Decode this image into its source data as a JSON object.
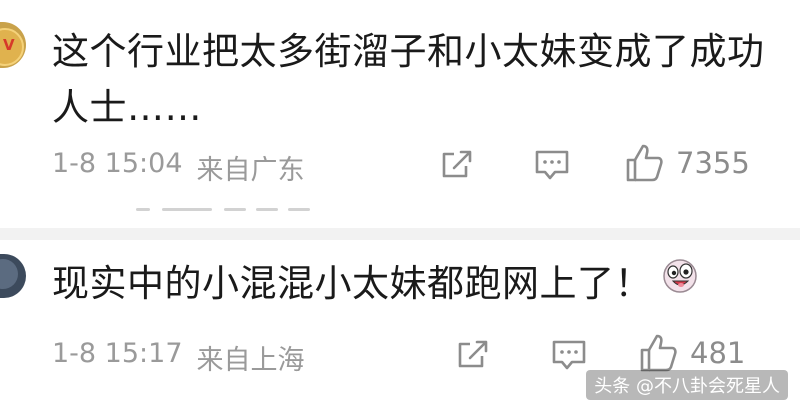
{
  "comments": [
    {
      "text": "这个行业把太多街溜子和小太妹变成了成功人士……",
      "date": "1-8 15:04",
      "location": "来自广东",
      "like_count": "7355",
      "avatar_icon": "badge-avatar",
      "actions": [
        "share-icon",
        "reply-icon",
        "like-icon"
      ]
    },
    {
      "text": "现实中的小混混小太妹都跑网上了！",
      "date": "1-8 15:17",
      "location": "来自上海",
      "like_count": "481",
      "emoji": "funny-face-emoji",
      "avatar_icon": "dark-avatar",
      "actions": [
        "share-icon",
        "reply-icon",
        "like-icon"
      ]
    }
  ],
  "watermark": "头条 @不八卦会死星人",
  "colors": {
    "text": "#1a1a1a",
    "meta": "#9a9a9a",
    "icon": "#8c8c8c",
    "divider": "#f2f2f2"
  }
}
